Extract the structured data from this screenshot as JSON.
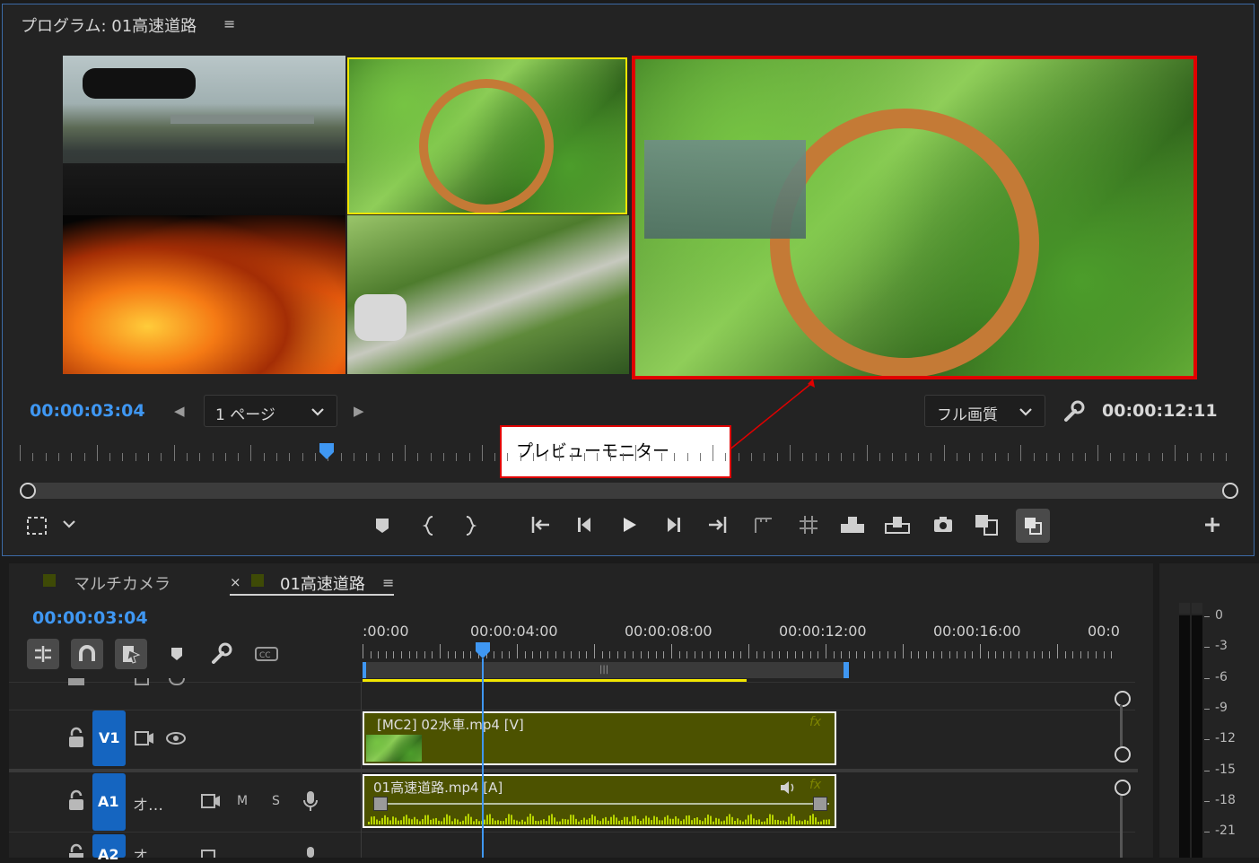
{
  "program": {
    "title": "プログラム: 01高速道路",
    "menu_glyph": "≡",
    "current_time": "00:00:03:04",
    "page_select": "1 ページ",
    "quality_select": "フル画質",
    "duration": "00:00:12:11",
    "prev_page_glyph": "◀",
    "next_page_glyph": "▶"
  },
  "annotation": {
    "callout_text": "プレビューモニター",
    "highlight_color": "#e00000",
    "selected_angle_color": "#f2e600"
  },
  "timeline": {
    "tabs": [
      {
        "label": "マルチカメラ",
        "close": ""
      },
      {
        "label": "01高速道路",
        "close": "×"
      }
    ],
    "menu_glyph": "≡",
    "current_time": "00:00:03:04",
    "ruler_labels": [
      ":00:00",
      "00:00:04:00",
      "00:00:08:00",
      "00:00:12:00",
      "00:00:16:00",
      "00:0"
    ],
    "tracks": {
      "v1": {
        "label": "V1",
        "lock": "🔓",
        "eye": "◉"
      },
      "a1": {
        "label": "A1",
        "name": "オ…",
        "m": "M",
        "s": "S"
      },
      "a2": {
        "label": "A2",
        "name": "オ"
      }
    },
    "clips": {
      "video": "[MC2] 02水車.mp4 [V]",
      "audio": "01高速道路.mp4 [A]",
      "fx": "fx"
    },
    "track_colors": {
      "clip_fill": "#4c5200",
      "track_button": "#1565c0",
      "playhead": "#3f97f2"
    }
  },
  "meter": {
    "labels": [
      "0",
      "-3",
      "-6",
      "-9",
      "-12",
      "-15",
      "-18",
      "-21"
    ]
  }
}
